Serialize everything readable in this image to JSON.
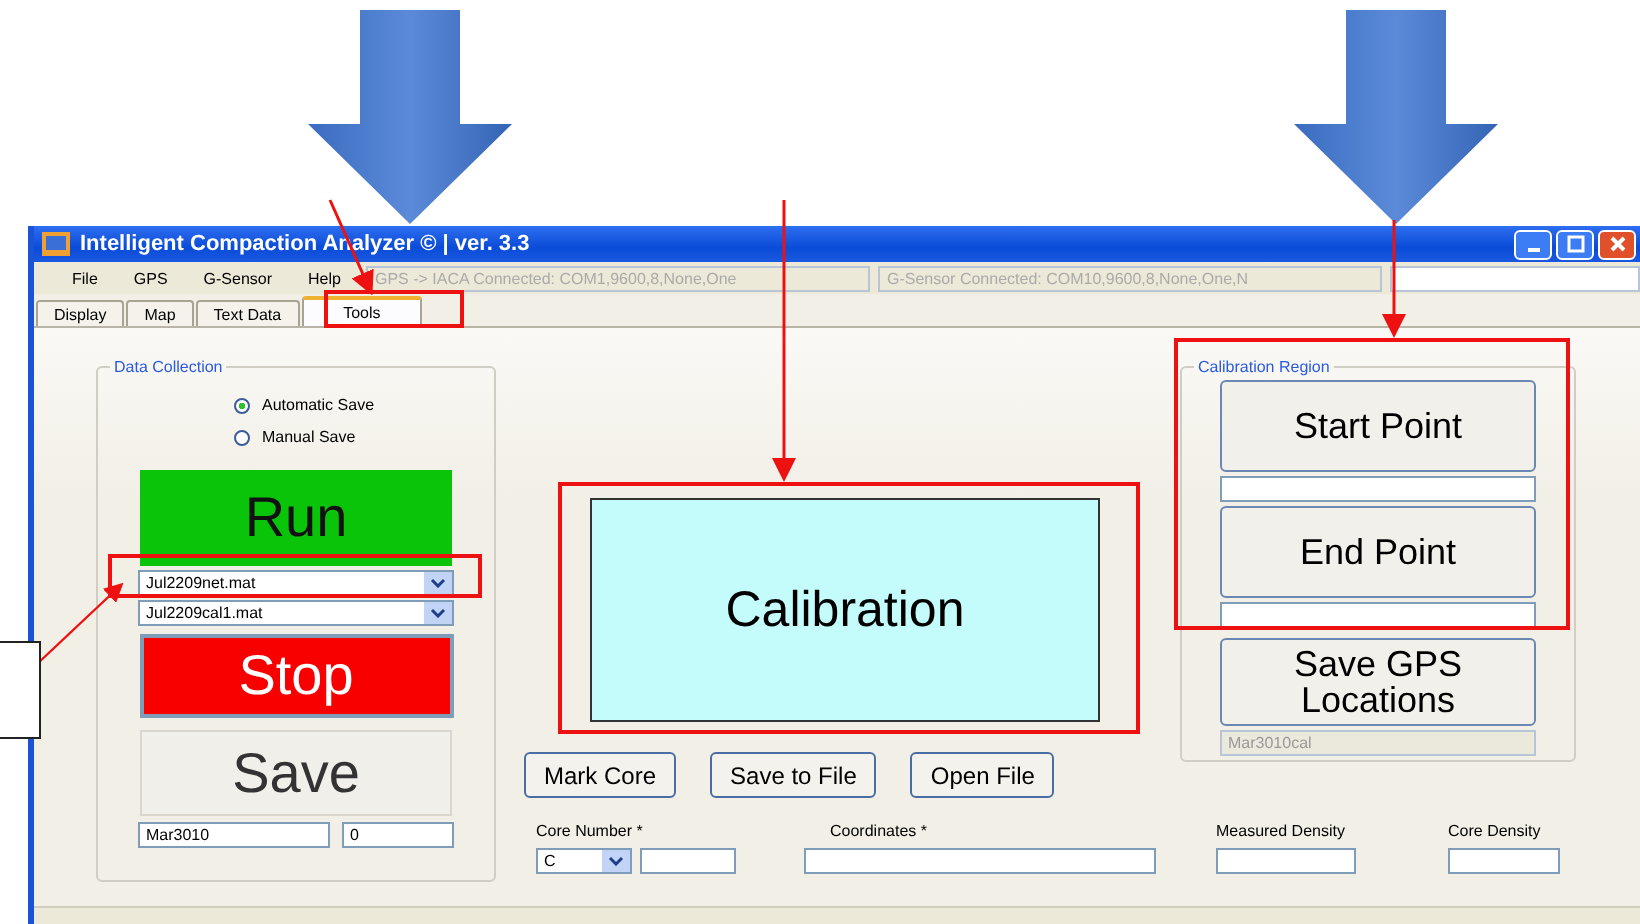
{
  "window": {
    "title": "Intelligent Compaction Analyzer © | ver. 3.3"
  },
  "menu": [
    "File",
    "GPS",
    "G-Sensor",
    "Help"
  ],
  "status_fields": [
    "GPS -> IACA Connected: COM1,9600,8,None,One",
    "G-Sensor Connected: COM10,9600,8,None,One,N"
  ],
  "tabs": [
    {
      "label": "Display",
      "selected": false
    },
    {
      "label": "Map",
      "selected": false
    },
    {
      "label": "Text Data",
      "selected": false
    },
    {
      "label": "Tools",
      "selected": true
    }
  ],
  "data_collection": {
    "title": "Data Collection",
    "save_modes": [
      {
        "label": "Automatic Save",
        "selected": true
      },
      {
        "label": "Manual Save",
        "selected": false
      }
    ],
    "run_label": "Run",
    "files": [
      "Jul2209net.mat",
      "Jul2209cal1.mat"
    ],
    "stop_label": "Stop",
    "save_label": "Save",
    "file_name": "Mar3010",
    "counter": "0"
  },
  "calibration_button": "Calibration",
  "actions": [
    "Mark Core",
    "Save to File",
    "Open File"
  ],
  "calibration_region": {
    "title": "Calibration Region",
    "start_label": "Start Point",
    "end_label": "End Point",
    "save_gps_label": "Save GPS Locations",
    "file_name": "Mar3010cal",
    "file_disabled": true
  },
  "core_form": {
    "core_number_label": "Core Number *",
    "core_prefix": "C",
    "coordinates_label": "Coordinates *",
    "measured_label": "Measured Density",
    "core_density_label": "Core Density"
  }
}
